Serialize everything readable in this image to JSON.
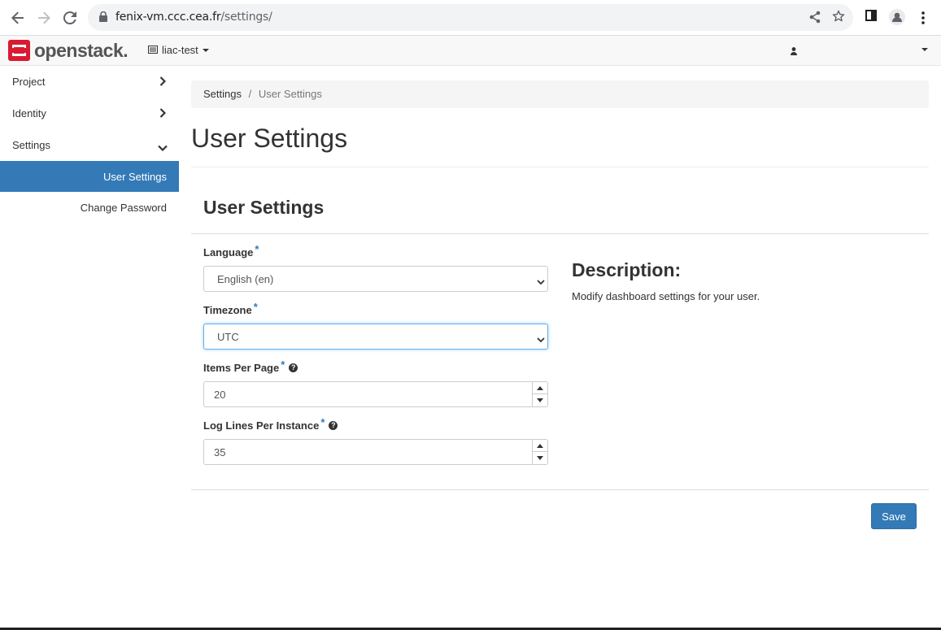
{
  "browser": {
    "url_host": "fenix-vm.ccc.cea.fr",
    "url_path": "/settings/"
  },
  "topbar": {
    "brand": "openstack.",
    "project": "liac-test",
    "brand_color": "#da1a32"
  },
  "sidebar": {
    "items": [
      {
        "label": "Project"
      },
      {
        "label": "Identity"
      },
      {
        "label": "Settings"
      }
    ],
    "sub_items": [
      {
        "label": "User Settings",
        "active": true
      },
      {
        "label": "Change Password",
        "active": false
      }
    ]
  },
  "breadcrumb": {
    "root": "Settings",
    "separator": "/",
    "current": "User Settings"
  },
  "page": {
    "title": "User Settings",
    "form_title": "User Settings"
  },
  "form": {
    "required_mark": "*",
    "language": {
      "label": "Language",
      "value": "English (en)"
    },
    "timezone": {
      "label": "Timezone",
      "value": "UTC"
    },
    "items_per_page": {
      "label": "Items Per Page",
      "value": "20"
    },
    "log_lines": {
      "label": "Log Lines Per Instance",
      "value": "35"
    },
    "save_label": "Save"
  },
  "description": {
    "title": "Description:",
    "text": "Modify dashboard settings for your user."
  },
  "colors": {
    "primary": "#337ab7",
    "active_sidebar": "#337ab7"
  }
}
